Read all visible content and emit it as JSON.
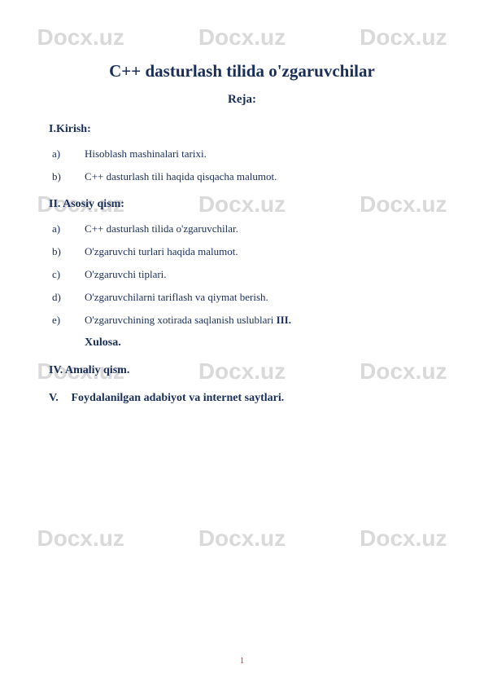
{
  "watermark": "Docx.uz",
  "title": "C++ dasturlash tilida o'zgaruvchilar",
  "subtitle": "Reja:",
  "section1": {
    "heading": "I.Kirish:",
    "items": [
      {
        "marker": "a)",
        "text": "Hisoblash mashinalari tarixi."
      },
      {
        "marker": "b)",
        "text": "C++ dasturlash tili haqida qisqacha malumot."
      }
    ]
  },
  "section2": {
    "heading": "II. Asosiy qism:",
    "items": [
      {
        "marker": "a)",
        "text": "C++ dasturlash tilida o'zgaruvchilar."
      },
      {
        "marker": "b)",
        "text": "O'zgaruvchi turlari haqida malumot."
      },
      {
        "marker": "c)",
        "text": "O'zgaruvchi tiplari."
      },
      {
        "marker": "d)",
        "text": "O'zgaruvchilarni tariflash va qiymat berish."
      },
      {
        "marker": "e)",
        "text": "O'zgaruvchining xotirada saqlanish uslublari ",
        "suffix": "III."
      }
    ]
  },
  "xulosa": "Xulosa.",
  "section4": "IV. Amaliy qism.",
  "section5": {
    "marker": "V.",
    "text": "Foydalanilgan adabiyot va internet saytlari."
  },
  "pageNumber": "1"
}
